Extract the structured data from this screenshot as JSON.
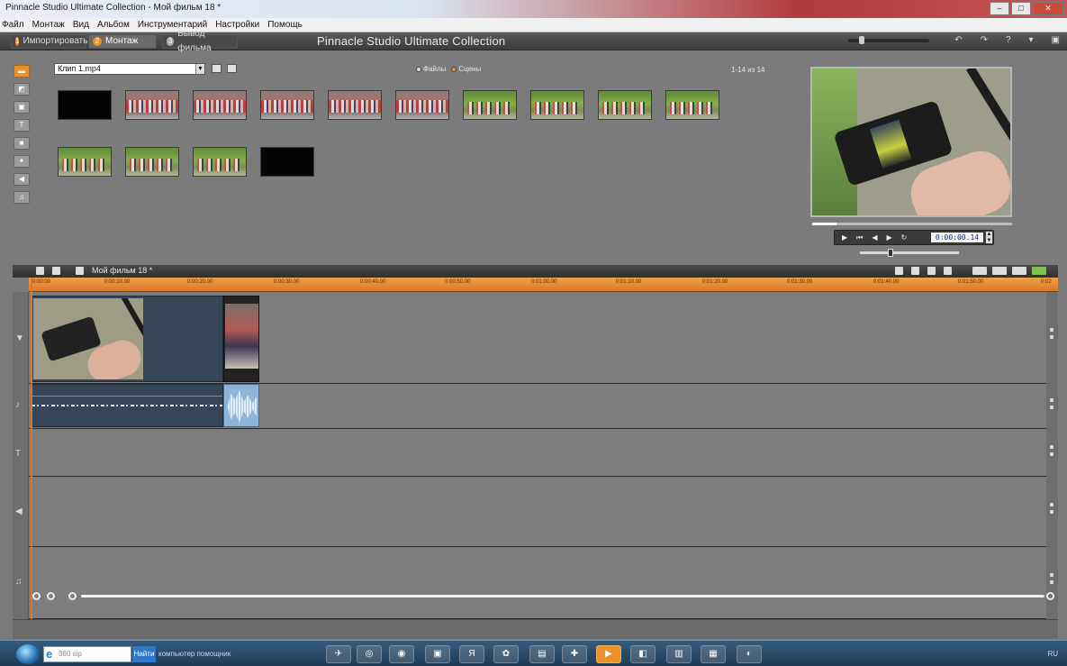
{
  "window": {
    "title": "Pinnacle Studio Ultimate Collection - Мой фильм 18 *",
    "buttons": [
      "–",
      "□",
      "✕"
    ]
  },
  "menu": [
    "Файл",
    "Монтаж",
    "Вид",
    "Альбом",
    "Инструментарий",
    "Настройки",
    "Помощь"
  ],
  "modes": {
    "import": "Импортировать",
    "edit": "Монтаж",
    "export": "Вывод фильма"
  },
  "app_title": "Pinnacle Studio Ultimate Collection",
  "album": {
    "file": "Клип 1.mp4",
    "view_files": "Файлы",
    "view_scenes": "Сцены",
    "page_count": "1-14 из 14",
    "thumbnails": [
      "black",
      "crowd",
      "crowd",
      "crowd",
      "crowd",
      "crowd",
      "park",
      "park",
      "park",
      "park",
      "park",
      "park",
      "park",
      "black"
    ]
  },
  "preview": {
    "timecode": "0:00:00.14",
    "progress": 0.12,
    "volume": 0.3
  },
  "timeline": {
    "project_name": "Мой фильм 18 *",
    "ruler_ticks": [
      "0:00:00",
      "0:00:10.00",
      "0:00:20.00",
      "0:00:30.00",
      "0:00:40.00",
      "0:00:50.00",
      "0:01:00.00",
      "0:01:10.00",
      "0:01:20.00",
      "0:01:30.00",
      "0:01:40.00",
      "0:01:50.00",
      "0:02"
    ]
  },
  "taskbar": {
    "search_placeholder": "360 sip",
    "find_label": "Найти",
    "search_hint": "компьютер помощник",
    "tray": "RU"
  }
}
